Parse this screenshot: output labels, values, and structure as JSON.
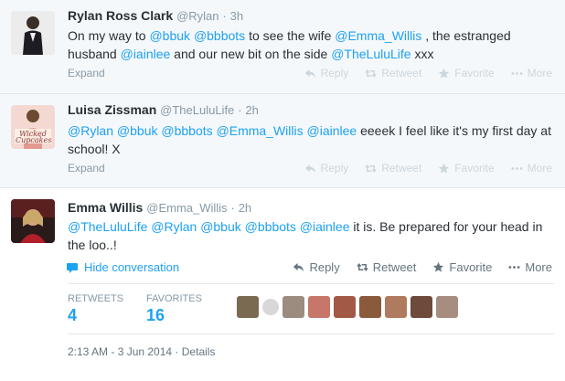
{
  "tweets": [
    {
      "name": "Rylan Ross Clark",
      "handle": "@Rylan",
      "dot": "·",
      "time": "3h",
      "text": [
        {
          "t": "On my way to ",
          "m": false
        },
        {
          "t": "@bbuk",
          "m": true
        },
        {
          "t": " ",
          "m": false
        },
        {
          "t": "@bbbots",
          "m": true
        },
        {
          "t": " to see the wife ",
          "m": false
        },
        {
          "t": "@Emma_Willis",
          "m": true
        },
        {
          "t": " , the estranged husband ",
          "m": false
        },
        {
          "t": "@iainlee",
          "m": true
        },
        {
          "t": " and our new bit on the side ",
          "m": false
        },
        {
          "t": "@TheLuluLife",
          "m": true
        },
        {
          "t": " xxx",
          "m": false
        }
      ],
      "expand": "Expand",
      "avatar_icon": "user-avatar-suit"
    },
    {
      "name": "Luisa Zissman",
      "handle": "@TheLuluLife",
      "dot": "·",
      "time": "2h",
      "text": [
        {
          "t": "@Rylan",
          "m": true
        },
        {
          "t": " ",
          "m": false
        },
        {
          "t": "@bbuk",
          "m": true
        },
        {
          "t": " ",
          "m": false
        },
        {
          "t": "@bbbots",
          "m": true
        },
        {
          "t": " ",
          "m": false
        },
        {
          "t": "@Emma_Willis",
          "m": true
        },
        {
          "t": " ",
          "m": false
        },
        {
          "t": "@iainlee",
          "m": true
        },
        {
          "t": " eeeek I feel like it's my first day at school! X",
          "m": false
        }
      ],
      "expand": "Expand",
      "avatar_icon": "cupcakes-book-avatar",
      "avatar_text": "Wicked Cupcakes"
    },
    {
      "name": "Emma Willis",
      "handle": "@Emma_Willis",
      "dot": "·",
      "time": "2h",
      "text": [
        {
          "t": "@TheLuluLife",
          "m": true
        },
        {
          "t": " ",
          "m": false
        },
        {
          "t": "@Rylan",
          "m": true
        },
        {
          "t": " ",
          "m": false
        },
        {
          "t": "@bbuk",
          "m": true
        },
        {
          "t": " ",
          "m": false
        },
        {
          "t": "@bbbots",
          "m": true
        },
        {
          "t": " ",
          "m": false
        },
        {
          "t": "@iainlee",
          "m": true
        },
        {
          "t": " it is. Be prepared for your head in the loo..!",
          "m": false
        }
      ],
      "avatar_icon": "user-avatar-red"
    }
  ],
  "actions": {
    "reply": "Reply",
    "retweet": "Retweet",
    "favorite": "Favorite",
    "more": "More"
  },
  "hide_conversation": "Hide conversation",
  "stats": {
    "retweets_label": "RETWEETS",
    "retweets_value": "4",
    "favorites_label": "FAVORITES",
    "favorites_value": "16"
  },
  "timestamp": "2:13 AM - 3 Jun 2014",
  "timestamp_sep": "·",
  "details": "Details",
  "favoriters_colors": [
    "#7b6a52",
    "#d8d8d8",
    "#9c8c80",
    "#c7766a",
    "#a35a45",
    "#8a5a3c",
    "#b07a5e",
    "#6e4a3a",
    "#a68d7f"
  ],
  "colors": {
    "link": "#1da1f2",
    "muted": "#8899a6",
    "text": "#292f33"
  }
}
